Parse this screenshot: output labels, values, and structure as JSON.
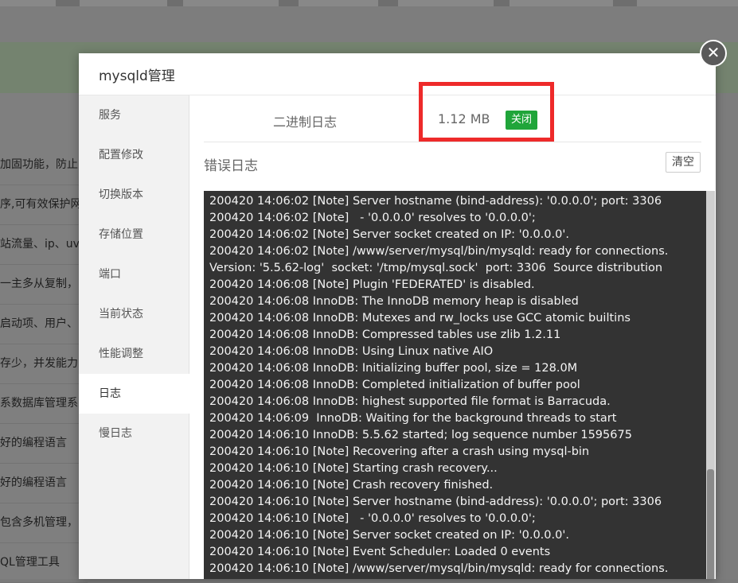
{
  "background": {
    "rows": [
      "加固功能，防止",
      "序,可有效保护网",
      "站流量、ip、uv",
      "一主多从复制，",
      "启动项、用户、",
      "存少，并发能力",
      "系数据库管理系",
      "好的编程语言",
      "好的编程语言",
      "包含多机管理，",
      "QL管理工具"
    ]
  },
  "modal": {
    "title": "mysqld管理",
    "close_symbol": "✕"
  },
  "sidebar": {
    "items": [
      {
        "label": "服务"
      },
      {
        "label": "配置修改"
      },
      {
        "label": "切换版本"
      },
      {
        "label": "存储位置"
      },
      {
        "label": "端口"
      },
      {
        "label": "当前状态"
      },
      {
        "label": "性能调整"
      },
      {
        "label": "日志",
        "active": true
      },
      {
        "label": "慢日志"
      }
    ]
  },
  "binlog": {
    "label": "二进制日志",
    "size": "1.12 MB",
    "status": "关闭",
    "status_color": "#20a53a",
    "highlight_color": "#ee2a2a"
  },
  "error_log": {
    "title": "错误日志",
    "clear_label": "清空",
    "lines": [
      "200420 14:06:02 [Note] Server hostname (bind-address): '0.0.0.0'; port: 3306",
      "200420 14:06:02 [Note]   - '0.0.0.0' resolves to '0.0.0.0';",
      "200420 14:06:02 [Note] Server socket created on IP: '0.0.0.0'.",
      "200420 14:06:02 [Note] /www/server/mysql/bin/mysqld: ready for connections.",
      "Version: '5.5.62-log'  socket: '/tmp/mysql.sock'  port: 3306  Source distribution",
      "200420 14:06:08 [Note] Plugin 'FEDERATED' is disabled.",
      "200420 14:06:08 InnoDB: The InnoDB memory heap is disabled",
      "200420 14:06:08 InnoDB: Mutexes and rw_locks use GCC atomic builtins",
      "200420 14:06:08 InnoDB: Compressed tables use zlib 1.2.11",
      "200420 14:06:08 InnoDB: Using Linux native AIO",
      "200420 14:06:08 InnoDB: Initializing buffer pool, size = 128.0M",
      "200420 14:06:08 InnoDB: Completed initialization of buffer pool",
      "200420 14:06:08 InnoDB: highest supported file format is Barracuda.",
      "200420 14:06:09  InnoDB: Waiting for the background threads to start",
      "200420 14:06:10 InnoDB: 5.5.62 started; log sequence number 1595675",
      "200420 14:06:10 [Note] Recovering after a crash using mysql-bin",
      "200420 14:06:10 [Note] Starting crash recovery...",
      "200420 14:06:10 [Note] Crash recovery finished.",
      "200420 14:06:10 [Note] Server hostname (bind-address): '0.0.0.0'; port: 3306",
      "200420 14:06:10 [Note]   - '0.0.0.0' resolves to '0.0.0.0';",
      "200420 14:06:10 [Note] Server socket created on IP: '0.0.0.0'.",
      "200420 14:06:10 [Note] Event Scheduler: Loaded 0 events",
      "200420 14:06:10 [Note] /www/server/mysql/bin/mysqld: ready for connections."
    ]
  }
}
